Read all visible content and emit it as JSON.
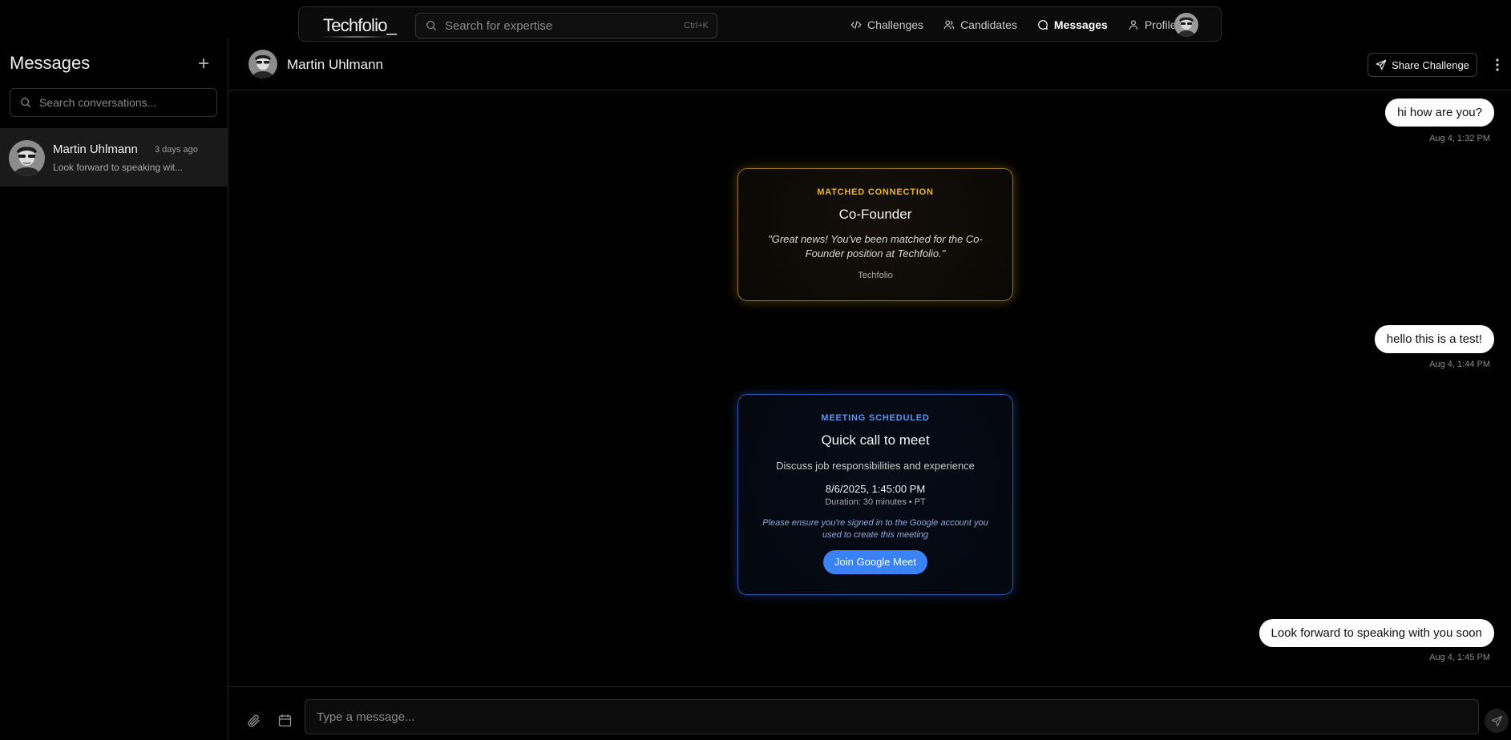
{
  "nav": {
    "logo": "Techfolio_",
    "search_placeholder": "Search for  expertise",
    "search_shortcut": "Ctrl+K",
    "links": [
      {
        "label": "Challenges",
        "icon": "code-icon"
      },
      {
        "label": "Candidates",
        "icon": "users-icon"
      },
      {
        "label": "Messages",
        "icon": "chat-icon",
        "active": true
      },
      {
        "label": "Profile",
        "icon": "user-icon"
      }
    ]
  },
  "sidebar": {
    "title": "Messages",
    "search_placeholder": "Search conversations...",
    "conversations": [
      {
        "name": "Martin Uhlmann",
        "time": "3 days ago",
        "preview": "Look forward to speaking wit..."
      }
    ]
  },
  "chat": {
    "contact_name": "Martin Uhlmann",
    "share_label": "Share Challenge",
    "messages": [
      {
        "text": "hi how are you?",
        "time": "Aug 4, 1:32 PM"
      },
      {
        "text": "hello this is a test!",
        "time": "Aug 4, 1:44 PM"
      },
      {
        "text": "Look forward to speaking with you soon",
        "time": "Aug 4, 1:45 PM"
      }
    ],
    "match_card": {
      "kicker": "MATCHED CONNECTION",
      "title": "Co-Founder",
      "quote": "\"Great news! You've been matched for the Co-Founder position at Techfolio.\"",
      "org": "Techfolio",
      "accent": "#e9b52c"
    },
    "meeting_card": {
      "kicker": "MEETING SCHEDULED",
      "title": "Quick call to meet",
      "description": "Discuss job responsibilities and experience",
      "datetime": "8/6/2025, 1:45:00 PM",
      "duration": "Duration: 30 minutes • PT",
      "note": "Please ensure you're signed in to the Google account you used to create this meeting",
      "button": "Join Google Meet",
      "accent": "#3b82f6"
    },
    "composer_placeholder": "Type a message..."
  }
}
